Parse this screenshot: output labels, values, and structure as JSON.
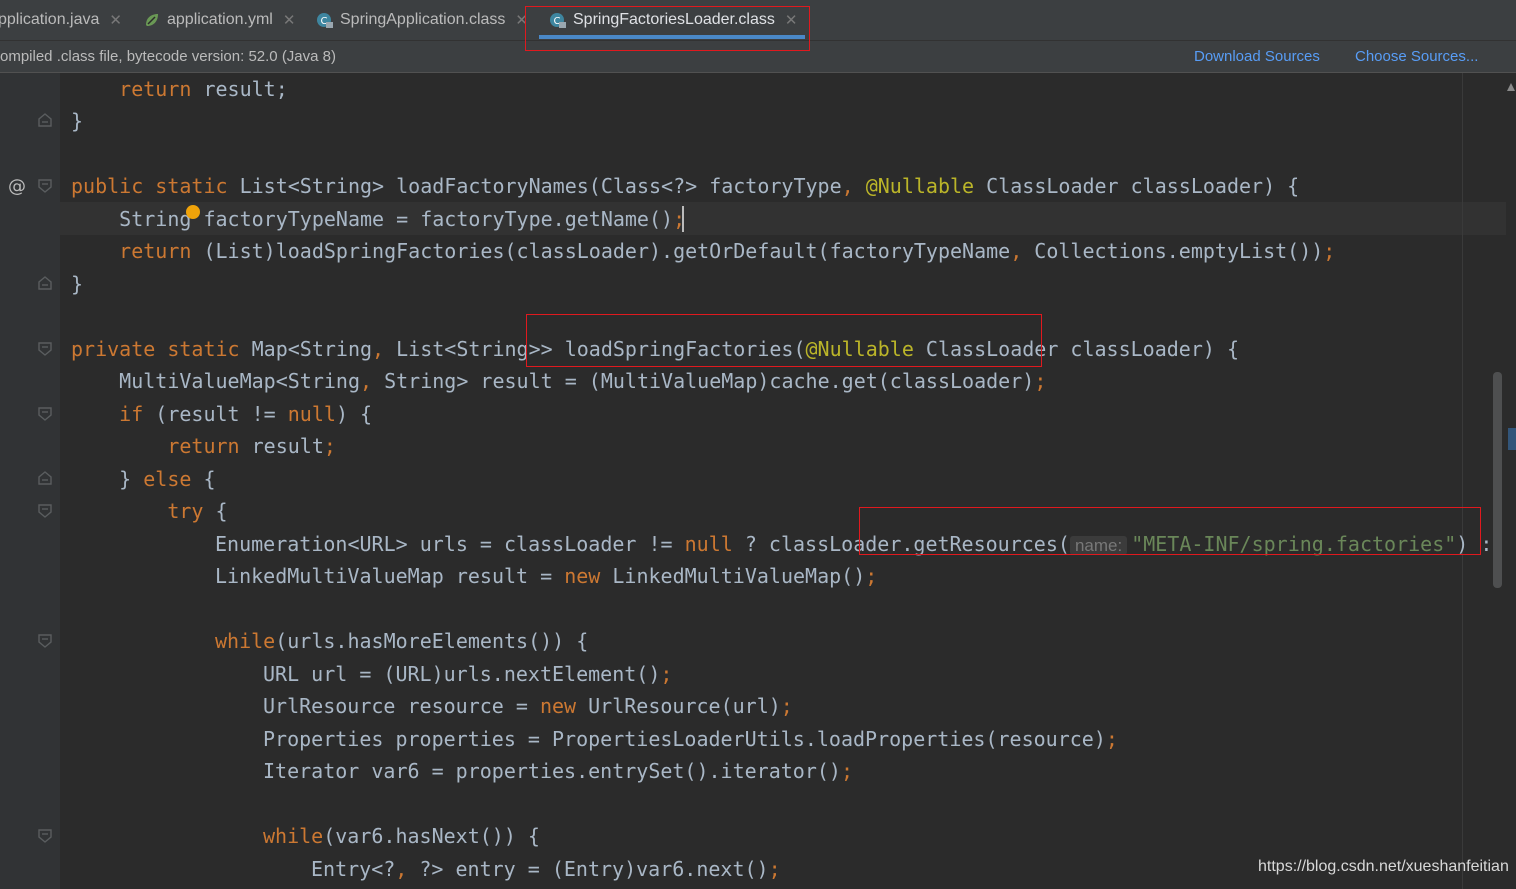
{
  "tabs": [
    {
      "label": "pplication.java",
      "icon": "java-class-icon",
      "closable": true
    },
    {
      "label": "application.yml",
      "icon": "spring-yaml-icon",
      "closable": true
    },
    {
      "label": "SpringApplication.class",
      "icon": "compiled-class-icon",
      "closable": true
    },
    {
      "label": "SpringFactoriesLoader.class",
      "icon": "compiled-class-icon",
      "closable": true,
      "active": true
    }
  ],
  "close_glyph": "✕",
  "banner": {
    "message": "ompiled .class file, bytecode version: 52.0 (Java 8)",
    "download_sources": "Download Sources",
    "choose_sources": "Choose Sources..."
  },
  "gutter": {
    "override_marker": "@"
  },
  "code": {
    "l1_kw": "return",
    "l1_rest": " result;",
    "l2": "}",
    "l3_kw1": "public static",
    "l3_a": " List<String> loadFactoryNames(Class<?> factoryType",
    "l3_comma": ",",
    "l3_ann": " @Nullable",
    "l3_b": " ClassLoader classLoader) {",
    "l4_a": "String factoryTypeName = factoryType.getName()",
    "l4_semi": ";",
    "l5_kw": "return",
    "l5_a": " (List)loadSpringFactories(classLoader).getOrDefault(factoryTypeName",
    "l5_comma": ",",
    "l5_b": " Collections.emptyList())",
    "l5_semi": ";",
    "l6": "}",
    "l7_kw": "private static",
    "l7_a": " Map<String",
    "l7_comma": ",",
    "l7_b": " List<String>> loadSpringFactories(",
    "l7_ann": "@Nullable",
    "l7_c": " ClassLoader classLoader) {",
    "l8_a": "MultiValueMap<String",
    "l8_comma": ",",
    "l8_b": " String> result = (MultiValueMap)cache.get(classLoader)",
    "l8_semi": ";",
    "l9_kw": "if",
    "l9_a": " (result != ",
    "l9_null": "null",
    "l9_b": ") {",
    "l10_kw": "return",
    "l10_a": " result",
    "l10_semi": ";",
    "l11_a": "} ",
    "l11_kw": "else",
    "l11_b": " {",
    "l12_kw": "try",
    "l12_a": " {",
    "l13_a": "Enumeration<URL> urls = classLoader != ",
    "l13_null": "null",
    "l13_b": " ? classLoader.getResources(",
    "l13_hint": "name:",
    "l13_str": "\"META-INF/spring.factories\"",
    "l13_c": ") :",
    "l14_a": "LinkedMultiValueMap result = ",
    "l14_kw": "new",
    "l14_b": " LinkedMultiValueMap()",
    "l14_semi": ";",
    "l15_kw": "while",
    "l15_a": "(urls.hasMoreElements()) {",
    "l16_a": "URL url = (URL)urls.nextElement()",
    "l16_semi": ";",
    "l17_a": "UrlResource resource = ",
    "l17_kw": "new",
    "l17_b": " UrlResource(url)",
    "l17_semi": ";",
    "l18_a": "Properties properties = PropertiesLoaderUtils.loadProperties(resource)",
    "l18_semi": ";",
    "l19_a": "Iterator var6 = properties.entrySet().iterator()",
    "l19_semi": ";",
    "l20_kw": "while",
    "l20_a": "(var6.hasNext()) {",
    "l21_a": "Entry<?",
    "l21_comma": ",",
    "l21_b": " ?> entry = (Entry)var6.next()",
    "l21_semi": ";"
  },
  "watermark": "https://blog.csdn.net/xueshanfeitian",
  "colors": {
    "keyword": "#cc7832",
    "string": "#6a8759",
    "annotation": "#bbb529",
    "text": "#a9b7c6",
    "link": "#589df6",
    "highlight_box": "#e0191e"
  }
}
